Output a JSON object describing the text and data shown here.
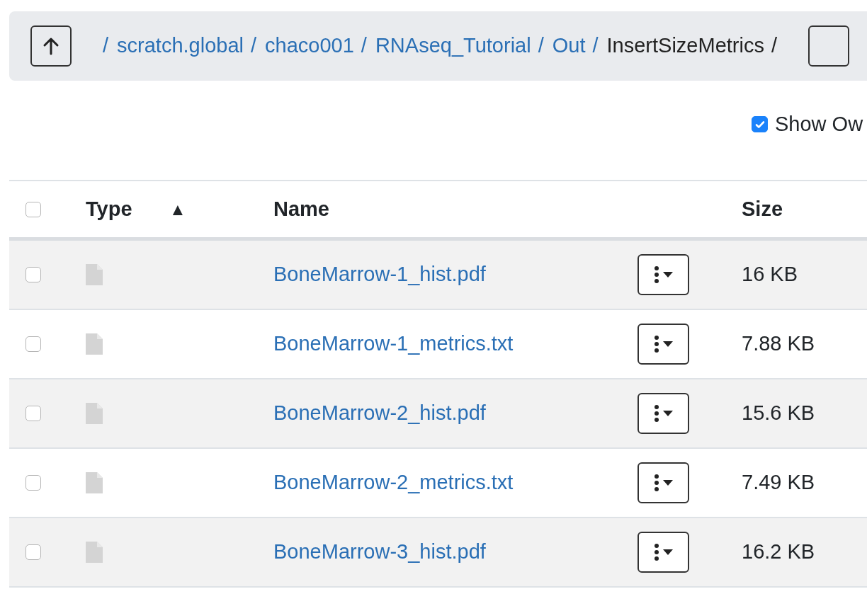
{
  "breadcrumb": {
    "links": [
      {
        "label": "scratch.global",
        "current": false
      },
      {
        "label": "chaco001",
        "current": false
      },
      {
        "label": "RNAseq_Tutorial",
        "current": false
      },
      {
        "label": "Out",
        "current": false
      },
      {
        "label": "InsertSizeMetrics",
        "current": true
      }
    ],
    "separator": "/"
  },
  "show_owner": {
    "label": "Show Ow",
    "checked": true
  },
  "table": {
    "select_all": {
      "checked": false
    },
    "columns": [
      {
        "label": "Type",
        "sort_icon": "▲"
      },
      {
        "label": "Name"
      },
      {
        "label": "Size"
      }
    ],
    "rows": [
      {
        "checked": false,
        "name": "BoneMarrow-1_hist.pdf",
        "size": "16 KB"
      },
      {
        "checked": false,
        "name": "BoneMarrow-1_metrics.txt",
        "size": "7.88 KB"
      },
      {
        "checked": false,
        "name": "BoneMarrow-2_hist.pdf",
        "size": "15.6 KB"
      },
      {
        "checked": false,
        "name": "BoneMarrow-2_metrics.txt",
        "size": "7.49 KB"
      },
      {
        "checked": false,
        "name": "BoneMarrow-3_hist.pdf",
        "size": "16.2 KB"
      }
    ]
  }
}
